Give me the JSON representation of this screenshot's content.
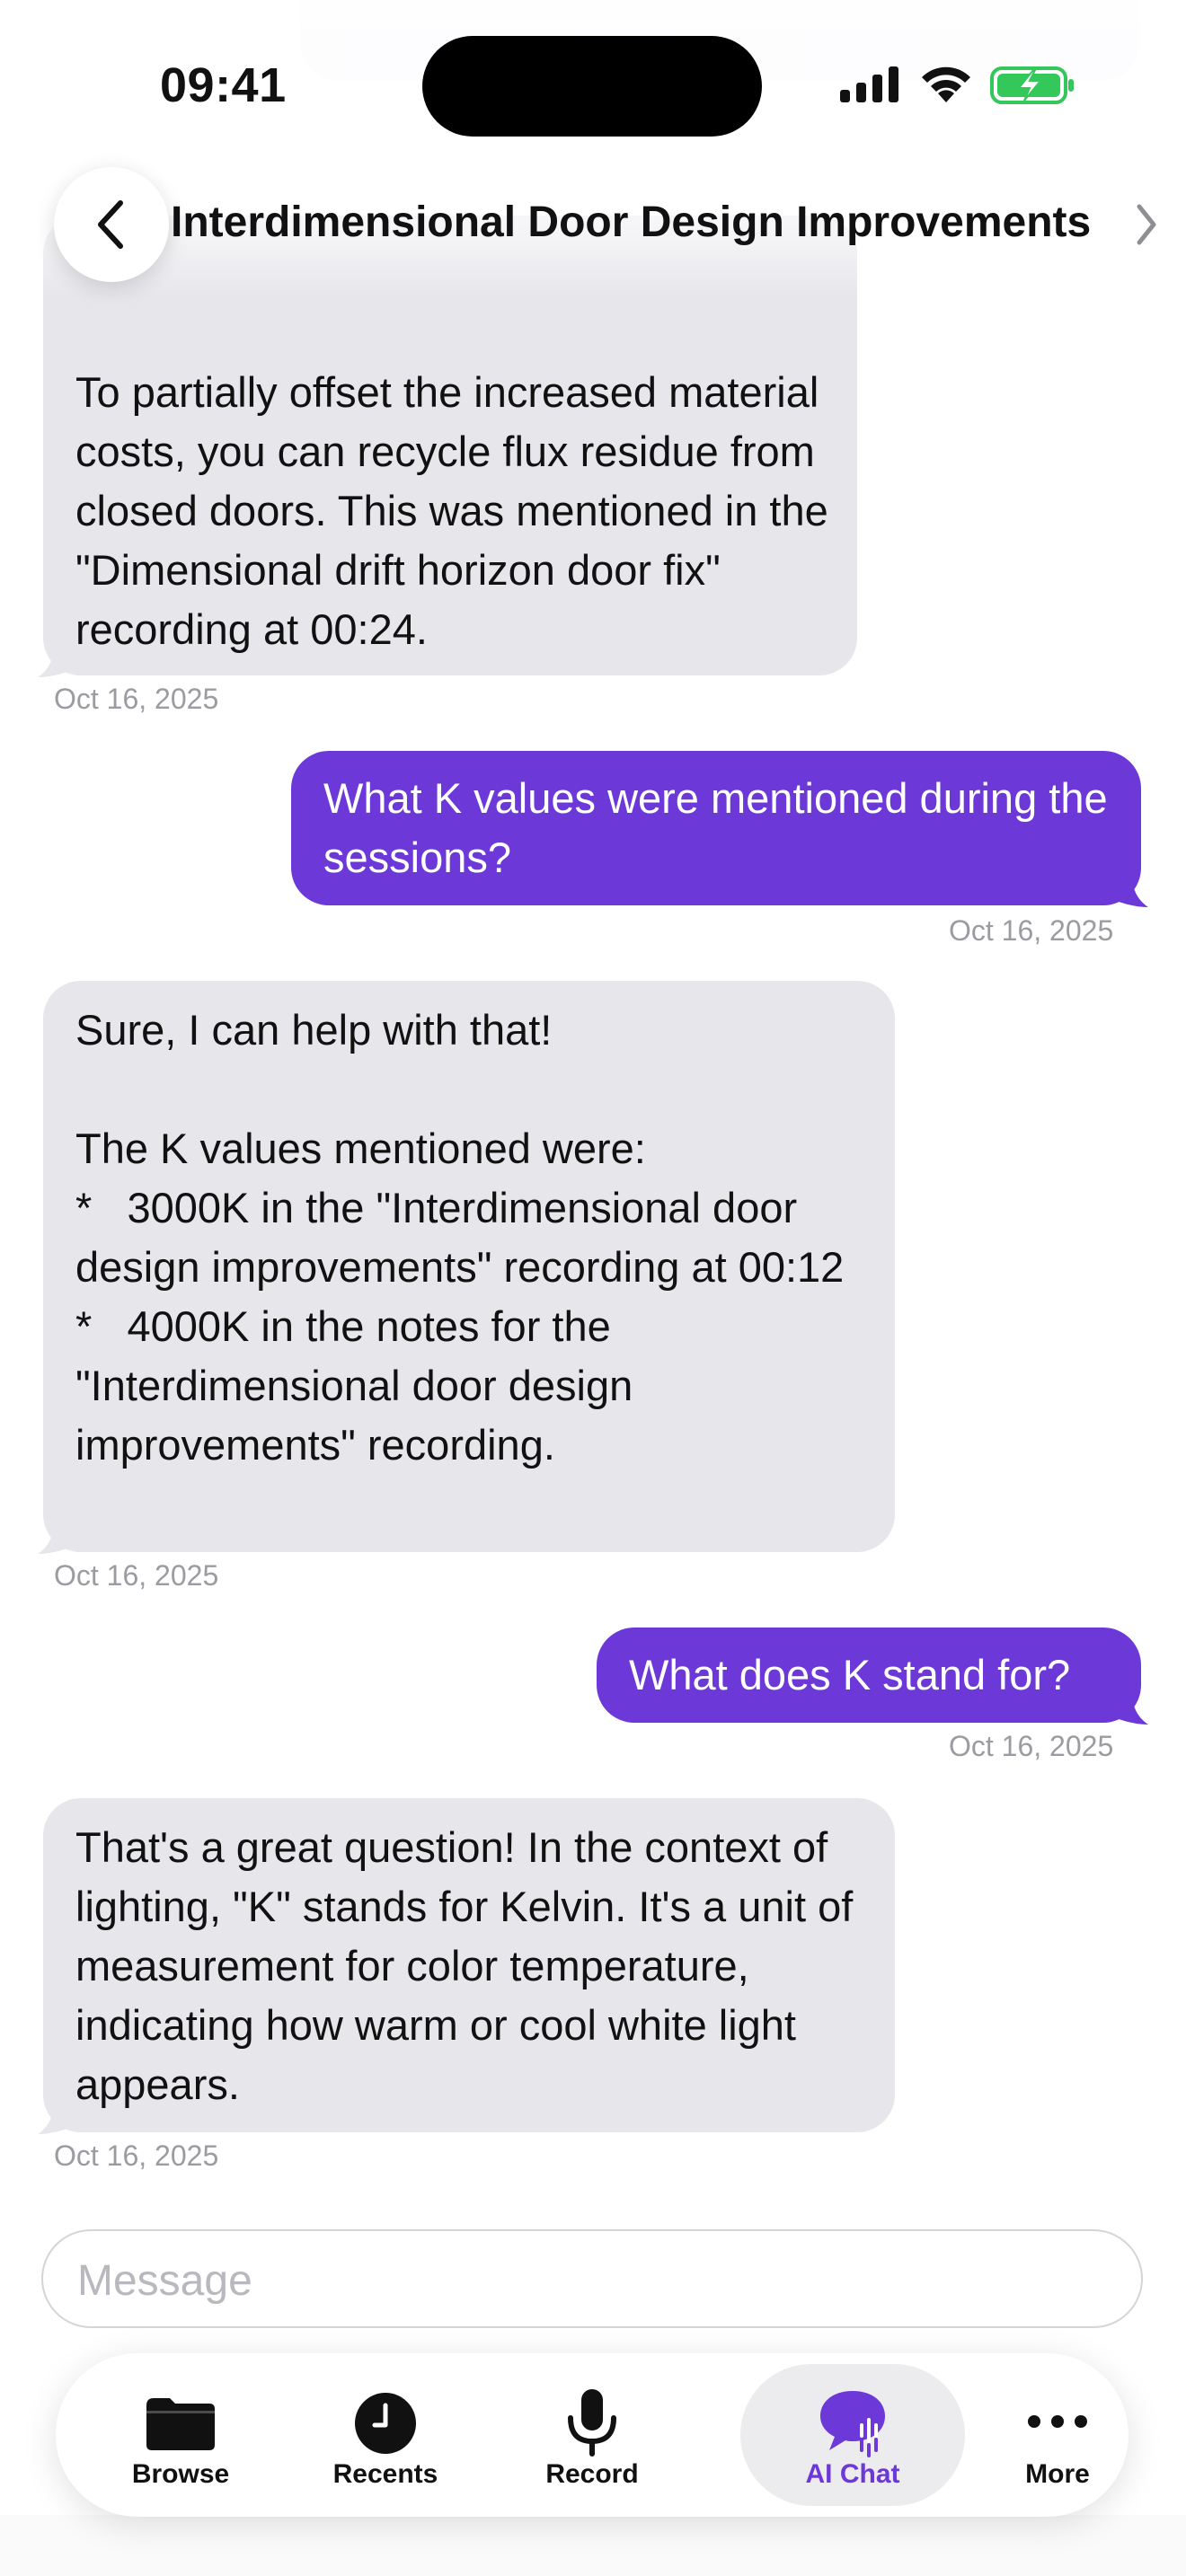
{
  "status_bar": {
    "time": "09:41"
  },
  "nav": {
    "title": "Interdimensional Door Design Improvements"
  },
  "messages": [
    {
      "role": "assistant",
      "text": "To partially offset the increased material costs, you can recycle flux residue from closed doors. This was mentioned in the \"Dimensional drift horizon door fix\" recording at 00:24.",
      "timestamp": "Oct 16, 2025"
    },
    {
      "role": "user",
      "text": "What K values were mentioned during the sessions?",
      "timestamp": "Oct 16, 2025"
    },
    {
      "role": "assistant",
      "text": "Sure, I can help with that!\n\nThe K values mentioned were:\n*   3000K in the \"Interdimensional door design improvements\" recording at 00:12\n*   4000K in the notes for the \"Interdimensional door design improvements\" recording.",
      "timestamp": "Oct 16, 2025"
    },
    {
      "role": "user",
      "text": "What does K stand for?",
      "timestamp": "Oct 16, 2025"
    },
    {
      "role": "assistant",
      "text": "That's a great question! In the context of lighting, \"K\" stands for Kelvin. It's a unit of measurement for color temperature, indicating how warm or cool white light appears.",
      "timestamp": "Oct 16, 2025"
    }
  ],
  "composer": {
    "placeholder": "Message"
  },
  "tabbar": {
    "items": [
      {
        "label": "Browse",
        "icon": "folder-icon"
      },
      {
        "label": "Recents",
        "icon": "clock-icon"
      },
      {
        "label": "Record",
        "icon": "microphone-icon"
      },
      {
        "label": "AI Chat",
        "icon": "ai-chat-icon",
        "active": true
      },
      {
        "label": "More",
        "icon": "more-icon"
      }
    ]
  },
  "colors": {
    "accent": "#6d38d8",
    "incoming_bubble": "#e7e6eb",
    "timestamp": "#9b9ba1",
    "battery_green": "#34c759"
  }
}
